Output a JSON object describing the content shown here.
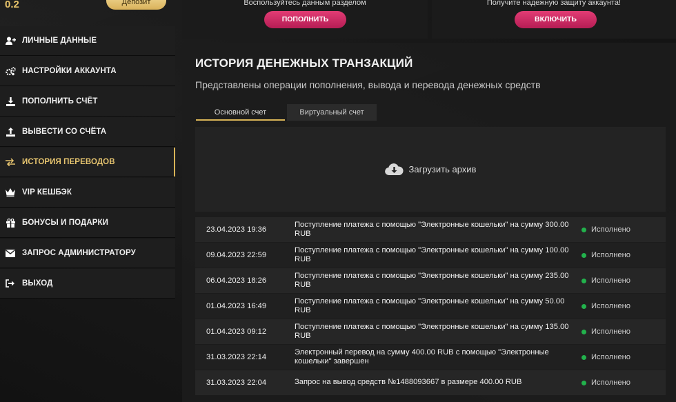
{
  "header": {
    "balance": "0.2",
    "deposit_label": "Депозит"
  },
  "sidebar": {
    "items": [
      {
        "label": "ЛИЧНЫЕ ДАННЫЕ",
        "icon": "user-plus-icon"
      },
      {
        "label": "НАСТРОЙКИ АККАУНТА",
        "icon": "gears-icon"
      },
      {
        "label": "ПОПОЛНИТЬ СЧЁТ",
        "icon": "download-icon"
      },
      {
        "label": "ВЫВЕСТИ СО СЧЁТА",
        "icon": "upload-icon"
      },
      {
        "label": "ИСТОРИЯ ПЕРЕВОДОВ",
        "icon": "transfer-arrows-icon",
        "active": true
      },
      {
        "label": "VIP КЕШБЭК",
        "icon": "crown-icon"
      },
      {
        "label": "БОНУСЫ И ПОДАРКИ",
        "icon": "gift-icon"
      },
      {
        "label": "ЗАПРОС АДМИНИСТРАТОРУ",
        "icon": "envelope-icon"
      },
      {
        "label": "ВЫХОД",
        "icon": "sign-out-icon"
      }
    ]
  },
  "cards": {
    "left_text": "Воспользуйтесь данным разделом",
    "left_button": "ПОПОЛНИТЬ",
    "right_text": "Получите надежную защиту аккаунта!",
    "right_button": "ВКЛЮЧИТЬ"
  },
  "main": {
    "title": "ИСТОРИЯ ДЕНЕЖНЫХ ТРАНЗАКЦИЙ",
    "subtitle": "Представлены операции пополнения, вывода и перевода денежных средств",
    "tabs": [
      "Основной счет",
      "Виртуальный счет"
    ],
    "archive_label": "Загрузить архив"
  },
  "transactions": [
    {
      "date": "23.04.2023 19:36",
      "desc": "Поступление платежа с помощью \"Электронные кошельки\" на сумму 300.00 RUB",
      "status": "Исполнено"
    },
    {
      "date": "09.04.2023 22:59",
      "desc": "Поступление платежа с помощью \"Электронные кошельки\" на сумму 100.00 RUB",
      "status": "Исполнено"
    },
    {
      "date": "06.04.2023 18:26",
      "desc": "Поступление платежа с помощью \"Электронные кошельки\" на сумму 235.00 RUB",
      "status": "Исполнено"
    },
    {
      "date": "01.04.2023 16:49",
      "desc": "Поступление платежа с помощью \"Электронные кошельки\" на сумму 50.00 RUB",
      "status": "Исполнено"
    },
    {
      "date": "01.04.2023 09:12",
      "desc": "Поступление платежа с помощью \"Электронные кошельки\" на сумму 135.00 RUB",
      "status": "Исполнено"
    },
    {
      "date": "31.03.2023 22:14",
      "desc": "Электронный перевод на сумму 400.00 RUB с помощью \"Электронные кошельки\" завершен",
      "status": "Исполнено"
    },
    {
      "date": "31.03.2023 22:04",
      "desc": "Запрос на вывод средств №1488093667 в размере 400.00 RUB",
      "status": "Исполнено"
    }
  ],
  "colors": {
    "accent_gold": "#d8b357",
    "button_pink": "#c9275f",
    "status_green": "#22b24c"
  }
}
